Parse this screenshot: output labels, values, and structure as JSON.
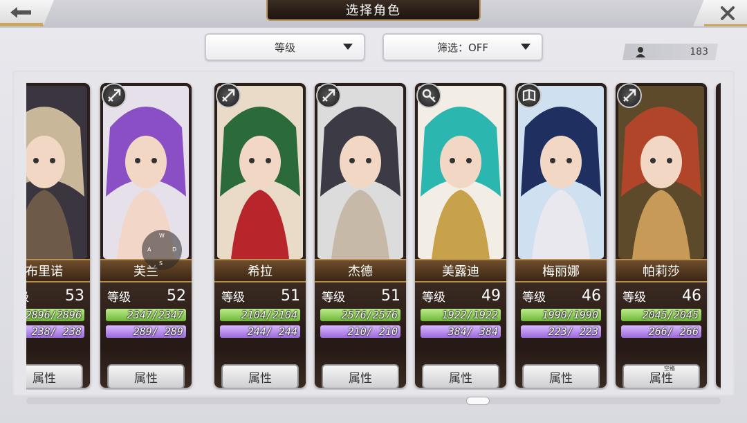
{
  "header": {
    "title": "选择角色",
    "back_icon": "back-arrow-icon",
    "close_icon": "close-icon"
  },
  "filters": {
    "sort_label": "等级",
    "filter_label": "筛选：OFF"
  },
  "roster_count": "183",
  "stat_label": "等级",
  "attr_label": "属性",
  "cards": [
    {
      "name": "布里诺",
      "level": "53",
      "hp": "2896/2896",
      "mp": "238/ 238",
      "icon": "sword-icon",
      "palette": [
        "#3b3540",
        "#c9b79a",
        "#6e5a48"
      ]
    },
    {
      "name": "芙兰",
      "level": "52",
      "hp": "2347/2347",
      "mp": "289/ 289",
      "icon": "arrow-icon",
      "palette": [
        "#e6e0ea",
        "#8a4fc4",
        "#f2d6c8"
      ]
    },
    {
      "name": "希拉",
      "level": "51",
      "hp": "2104/2104",
      "mp": "244/ 244",
      "icon": "arrow-icon",
      "palette": [
        "#eadbc9",
        "#2b6b3a",
        "#b8252a"
      ]
    },
    {
      "name": "杰德",
      "level": "51",
      "hp": "2576/2576",
      "mp": "210/ 210",
      "icon": "arrow-icon",
      "palette": [
        "#dcdcdc",
        "#3c3a44",
        "#c7b9a8"
      ]
    },
    {
      "name": "美露迪",
      "level": "49",
      "hp": "1922/1922",
      "mp": "384/ 384",
      "icon": "key-icon",
      "palette": [
        "#f2eee6",
        "#2bb7b0",
        "#c8a24a"
      ]
    },
    {
      "name": "梅丽娜",
      "level": "46",
      "hp": "1990/1990",
      "mp": "223/ 223",
      "icon": "book-icon",
      "palette": [
        "#cfe0f0",
        "#1f3060",
        "#e8e8ee"
      ]
    },
    {
      "name": "帕莉莎",
      "level": "46",
      "hp": "2045/2045",
      "mp": "266/ 266",
      "icon": "arrow-icon",
      "palette": [
        "#5c4a2a",
        "#b0452a",
        "#c89a58"
      ]
    }
  ],
  "overlay": {
    "joystick_keys": [
      "W",
      "A",
      "S",
      "D"
    ],
    "small_tag": "空格"
  }
}
